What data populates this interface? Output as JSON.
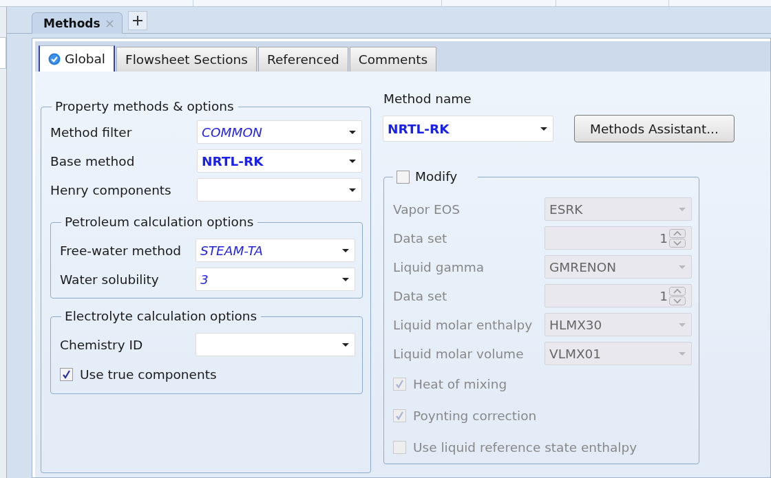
{
  "document_tabs": [
    {
      "label": "Methods",
      "selected": true
    }
  ],
  "tabs": [
    {
      "label": "Global",
      "selected": true,
      "checked": true
    },
    {
      "label": "Flowsheet Sections",
      "selected": false,
      "checked": false
    },
    {
      "label": "Referenced",
      "selected": false,
      "checked": false
    },
    {
      "label": "Comments",
      "selected": false,
      "checked": false
    }
  ],
  "property_methods": {
    "title": "Property methods & options",
    "rows": [
      {
        "label": "Method filter",
        "value": "COMMON",
        "kind": "italic"
      },
      {
        "label": "Base method",
        "value": "NRTL-RK",
        "kind": "bold"
      },
      {
        "label": "Henry components",
        "kind": "plain"
      }
    ],
    "groups": [
      {
        "title": "Petroleum calculation options",
        "rows": [
          {
            "label": "Free-water method",
            "value": "STEAM-TA",
            "kind": "italic"
          },
          {
            "label": "Water solubility",
            "value": "3",
            "kind": "italic"
          }
        ]
      },
      {
        "title": "Electrolyte calculation options",
        "rows": [
          {
            "label": "Chemistry ID",
            "kind": "plain"
          }
        ],
        "checkboxes": [
          {
            "label": "Use true components",
            "checked": true
          }
        ]
      }
    ]
  },
  "method_name": {
    "label": "Method name",
    "value": "NRTL-RK"
  },
  "methods_assistant_button": {
    "label": "Methods Assistant..."
  },
  "modify": {
    "label": "Modify",
    "checked": false,
    "disabled": true,
    "rows": [
      {
        "label": "Vapor EOS",
        "value": "ESRK",
        "kind": "dropdown"
      },
      {
        "label": "Data set",
        "value": "1",
        "kind": "spinner"
      },
      {
        "label": "Liquid gamma",
        "value": "GMRENON",
        "kind": "dropdown"
      },
      {
        "label": "Data set",
        "value": "1",
        "kind": "spinner"
      },
      {
        "label": "Liquid molar enthalpy",
        "value": "HLMX30",
        "kind": "dropdown"
      },
      {
        "label": "Liquid molar volume",
        "value": "VLMX01",
        "kind": "dropdown"
      }
    ],
    "checkboxes": [
      {
        "label": "Heat of mixing",
        "checked": true
      },
      {
        "label": "Poynting correction",
        "checked": true
      },
      {
        "label": "Use liquid reference state enthalpy",
        "checked": false
      }
    ]
  }
}
